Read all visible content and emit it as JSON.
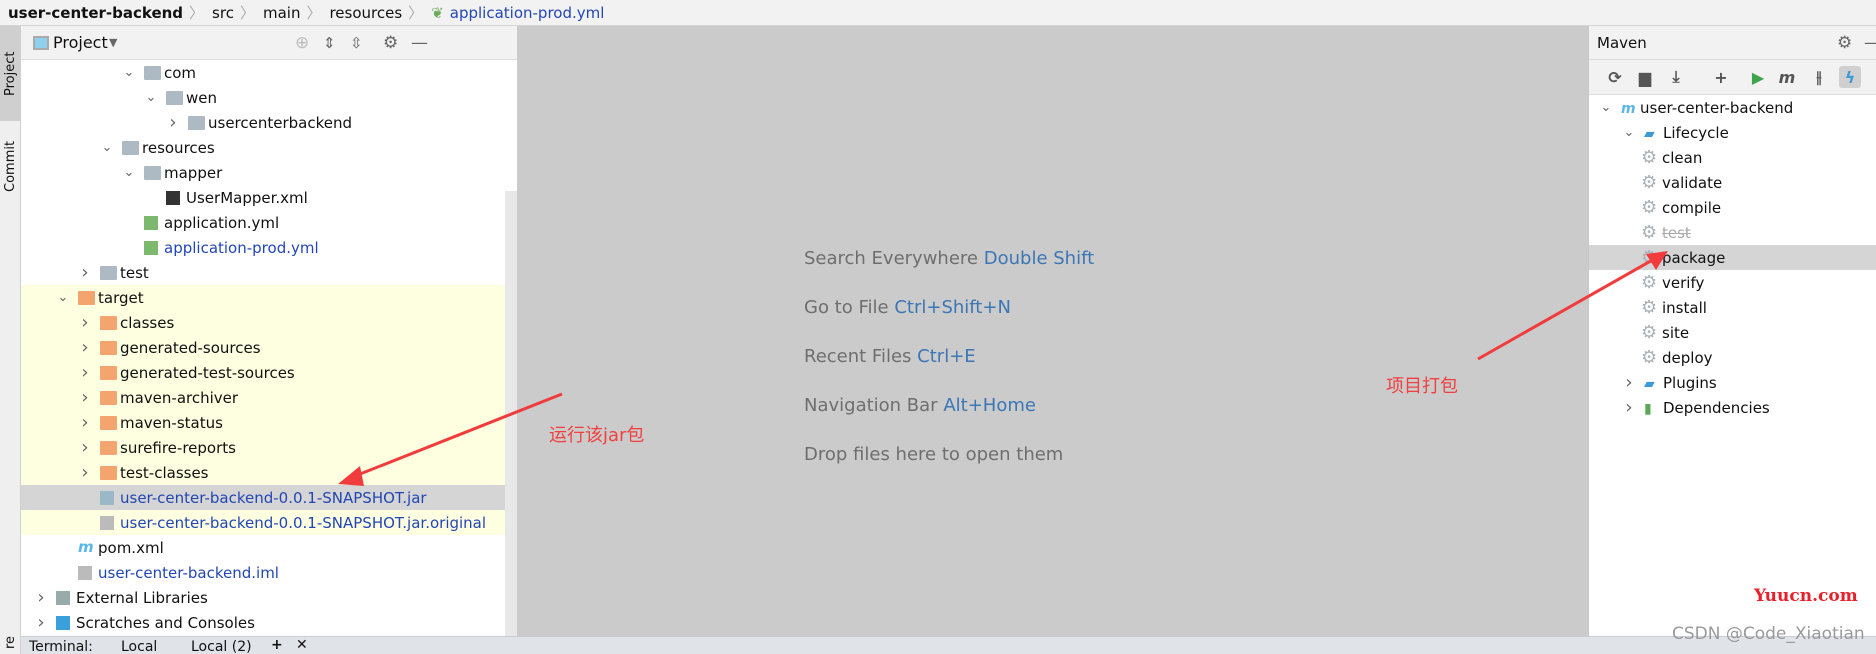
{
  "breadcrumb": [
    "user-center-backend",
    "src",
    "main",
    "resources",
    "application-prod.yml"
  ],
  "stripe": {
    "project": "Project",
    "commit": "Commit",
    "bottom": "re"
  },
  "project_panel": {
    "title": "Project",
    "tree": [
      {
        "label": "com",
        "level": 4,
        "arrow": "down",
        "icon": "package-folder"
      },
      {
        "label": "wen",
        "level": 5,
        "arrow": "down",
        "icon": "package-folder"
      },
      {
        "label": "usercenterbackend",
        "level": 6,
        "arrow": "right",
        "icon": "package-folder"
      },
      {
        "label": "resources",
        "level": 3,
        "arrow": "down",
        "icon": "resources-folder"
      },
      {
        "label": "mapper",
        "level": 4,
        "arrow": "down",
        "icon": "folder"
      },
      {
        "label": "UserMapper.xml",
        "level": 5,
        "arrow": "",
        "icon": "mybatis-file"
      },
      {
        "label": "application.yml",
        "level": 4,
        "arrow": "",
        "icon": "spring-file"
      },
      {
        "label": "application-prod.yml",
        "level": 4,
        "arrow": "",
        "icon": "spring-file",
        "blue": true
      },
      {
        "label": "test",
        "level": 2,
        "arrow": "right",
        "icon": "folder"
      },
      {
        "label": "target",
        "level": 1,
        "arrow": "down",
        "icon": "excluded-folder",
        "hl": true
      },
      {
        "label": "classes",
        "level": 2,
        "arrow": "right",
        "icon": "excluded-folder",
        "hl": true
      },
      {
        "label": "generated-sources",
        "level": 2,
        "arrow": "right",
        "icon": "excluded-folder",
        "hl": true
      },
      {
        "label": "generated-test-sources",
        "level": 2,
        "arrow": "right",
        "icon": "excluded-folder",
        "hl": true
      },
      {
        "label": "maven-archiver",
        "level": 2,
        "arrow": "right",
        "icon": "excluded-folder",
        "hl": true
      },
      {
        "label": "maven-status",
        "level": 2,
        "arrow": "right",
        "icon": "excluded-folder",
        "hl": true
      },
      {
        "label": "surefire-reports",
        "level": 2,
        "arrow": "right",
        "icon": "excluded-folder",
        "hl": true
      },
      {
        "label": "test-classes",
        "level": 2,
        "arrow": "right",
        "icon": "excluded-folder",
        "hl": true
      },
      {
        "label": "user-center-backend-0.0.1-SNAPSHOT.jar",
        "level": 2,
        "arrow": "",
        "icon": "jar-file",
        "blue": true,
        "selected": true
      },
      {
        "label": "user-center-backend-0.0.1-SNAPSHOT.jar.original",
        "level": 2,
        "arrow": "",
        "icon": "unknown-file",
        "blue": true,
        "hl": true
      },
      {
        "label": "pom.xml",
        "level": 1,
        "arrow": "",
        "icon": "maven-file"
      },
      {
        "label": "user-center-backend.iml",
        "level": 1,
        "arrow": "",
        "icon": "iml-file",
        "blue": true
      },
      {
        "label": "External Libraries",
        "level": 0,
        "arrow": "right",
        "icon": "libraries"
      },
      {
        "label": "Scratches and Consoles",
        "level": 0,
        "arrow": "right",
        "icon": "scratches"
      }
    ]
  },
  "editor_hints": [
    {
      "text": "Search Everywhere",
      "key": "Double Shift"
    },
    {
      "text": "Go to File",
      "key": "Ctrl+Shift+N"
    },
    {
      "text": "Recent Files",
      "key": "Ctrl+E"
    },
    {
      "text": "Navigation Bar",
      "key": "Alt+Home"
    },
    {
      "text": "Drop files here to open them",
      "key": ""
    }
  ],
  "maven": {
    "title": "Maven",
    "root": "user-center-backend",
    "lifecycle": "Lifecycle",
    "goals": [
      "clean",
      "validate",
      "compile",
      "test",
      "package",
      "verify",
      "install",
      "site",
      "deploy"
    ],
    "disabled_goal": "test",
    "selected_goal": "package",
    "plugins": "Plugins",
    "dependencies": "Dependencies"
  },
  "bottom": {
    "terminal": "Terminal:",
    "tabs": [
      "Local",
      "Local (2)"
    ]
  },
  "annotations": {
    "run_jar": "运行该jar包",
    "package_project": "项目打包",
    "color": "#f04040"
  },
  "watermarks": {
    "site": "Yuucn.com",
    "csdn": "CSDN @Code_Xiaotian"
  }
}
